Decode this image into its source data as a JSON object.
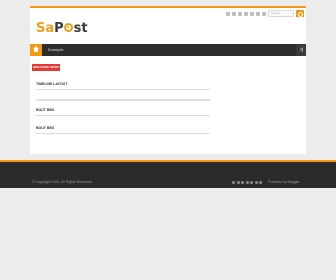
{
  "header": {
    "logo_part1": "Sa",
    "logo_part2": "P",
    "logo_part3": "st",
    "search_placeholder": "Search"
  },
  "navbar": {
    "item_label": "Example"
  },
  "breaking": {
    "label": "BREAKING NEWS"
  },
  "sections": [
    {
      "title": "TIMELINE LAYOUT"
    },
    {
      "title": "BOUT BBS"
    },
    {
      "title": "BOUT BBS"
    }
  ],
  "footer": {
    "copyright": "© Copyright 2024, All Rights Reserved",
    "powered": "Powered by Blogger"
  },
  "colors": {
    "accent": "#f39c12",
    "nav_bg": "#2d2d2d",
    "breaking_bg": "#e53935",
    "footer_bg": "#2b2b2b"
  }
}
